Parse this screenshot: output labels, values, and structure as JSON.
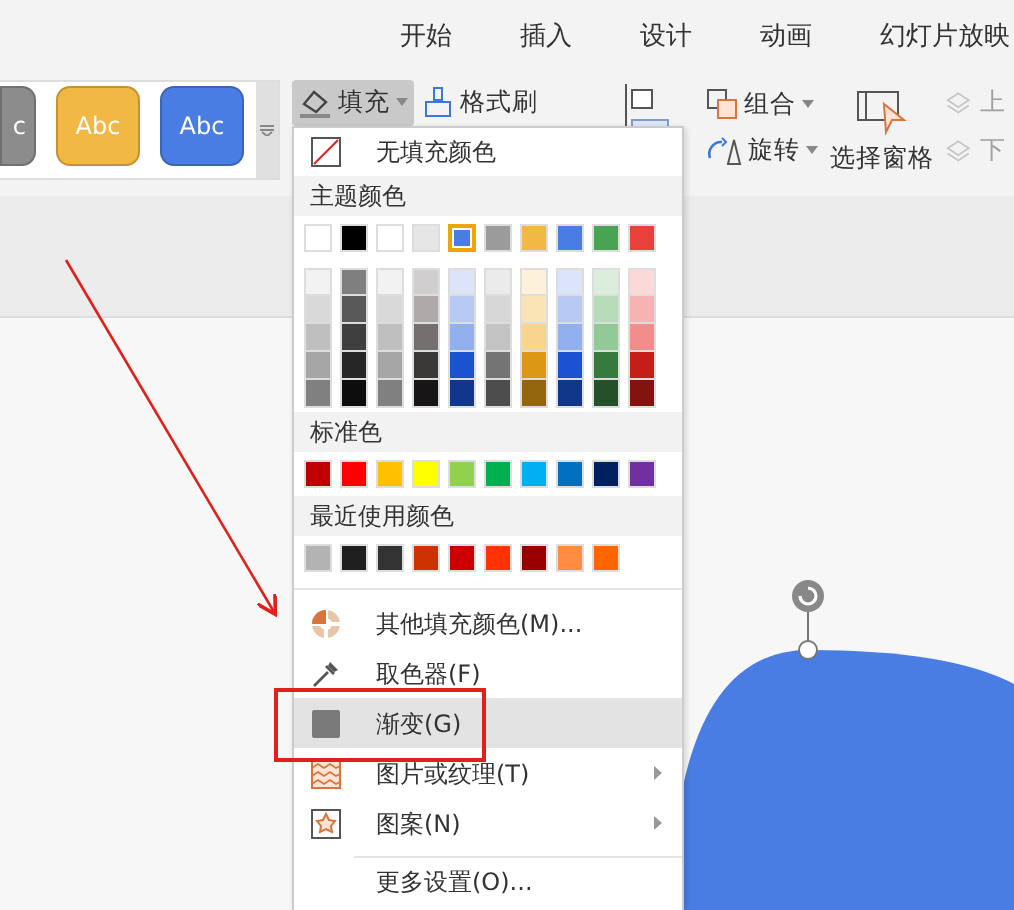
{
  "ribbon_tabs": [
    {
      "label": "开始"
    },
    {
      "label": "插入"
    },
    {
      "label": "设计"
    },
    {
      "label": "动画"
    },
    {
      "label": "幻灯片放映"
    }
  ],
  "style_gallery": [
    {
      "label": "c",
      "color": "#8c8c8c"
    },
    {
      "label": "Abc",
      "color": "#f2b844"
    },
    {
      "label": "Abc",
      "color": "#4a7de3"
    }
  ],
  "toolbar": {
    "fill_button": {
      "label": "填充",
      "pressed": true
    },
    "format_painter": {
      "label": "格式刷"
    },
    "group": {
      "label": "组合"
    },
    "rotate": {
      "label": "旋转"
    },
    "selection_pane": {
      "label": "选择窗格"
    },
    "bring_forward": {
      "label": "上",
      "disabled": true
    },
    "send_backward": {
      "label": "下",
      "disabled": true
    }
  },
  "fill_menu": {
    "no_fill": "无填充颜色",
    "theme_header": "主题颜色",
    "theme_colors": [
      {
        "color": "#ffffff",
        "selected": false
      },
      {
        "color": "#000000",
        "selected": false
      },
      {
        "color": "#ffffff",
        "selected": false
      },
      {
        "color": "#e7e6e6",
        "selected": false
      },
      {
        "color": "#4a7de3",
        "selected": true
      },
      {
        "color": "#9b9b9b",
        "selected": false
      },
      {
        "color": "#f2b844",
        "selected": false
      },
      {
        "color": "#4a7de3",
        "selected": false
      },
      {
        "color": "#4aa352",
        "selected": false
      },
      {
        "color": "#e8413c",
        "selected": false
      }
    ],
    "shade_rows": [
      {
        "swatches": [
          {
            "color": "#f2f2f2"
          },
          {
            "color": "#7f7f7f"
          },
          {
            "color": "#f2f2f2"
          },
          {
            "color": "#d0cece"
          },
          {
            "color": "#dbe4f9"
          },
          {
            "color": "#ebebeb"
          },
          {
            "color": "#fdf1d9"
          },
          {
            "color": "#dbe4f9"
          },
          {
            "color": "#dbeddc"
          },
          {
            "color": "#fad9d8"
          }
        ]
      },
      {
        "swatches": [
          {
            "color": "#d9d9d9"
          },
          {
            "color": "#595959"
          },
          {
            "color": "#d9d9d9"
          },
          {
            "color": "#aeaaaa"
          },
          {
            "color": "#b7caf3"
          },
          {
            "color": "#d7d7d7"
          },
          {
            "color": "#fae3b4"
          },
          {
            "color": "#b7caf3"
          },
          {
            "color": "#b6dbb9"
          },
          {
            "color": "#f6b3b1"
          }
        ]
      },
      {
        "swatches": [
          {
            "color": "#bfbfbf"
          },
          {
            "color": "#3f3f3f"
          },
          {
            "color": "#bfbfbf"
          },
          {
            "color": "#757070"
          },
          {
            "color": "#92afee"
          },
          {
            "color": "#c3c3c3"
          },
          {
            "color": "#f8d48e"
          },
          {
            "color": "#92afee"
          },
          {
            "color": "#92c997"
          },
          {
            "color": "#f18d8a"
          }
        ]
      },
      {
        "swatches": [
          {
            "color": "#a6a6a6"
          },
          {
            "color": "#262626"
          },
          {
            "color": "#a6a6a6"
          },
          {
            "color": "#3b3838"
          },
          {
            "color": "#1a52d0"
          },
          {
            "color": "#747474"
          },
          {
            "color": "#dc9812"
          },
          {
            "color": "#1a52d0"
          },
          {
            "color": "#377a3d"
          },
          {
            "color": "#c51d17"
          }
        ]
      },
      {
        "swatches": [
          {
            "color": "#808080"
          },
          {
            "color": "#0d0d0d"
          },
          {
            "color": "#808080"
          },
          {
            "color": "#171515"
          },
          {
            "color": "#11378a"
          },
          {
            "color": "#4d4d4d"
          },
          {
            "color": "#93650c"
          },
          {
            "color": "#11378a"
          },
          {
            "color": "#245129"
          },
          {
            "color": "#83130f"
          }
        ]
      }
    ],
    "standard_header": "标准色",
    "standard_colors": [
      {
        "color": "#c00000"
      },
      {
        "color": "#ff0000"
      },
      {
        "color": "#ffc000"
      },
      {
        "color": "#ffff00"
      },
      {
        "color": "#92d050"
      },
      {
        "color": "#00b050"
      },
      {
        "color": "#00b0f0"
      },
      {
        "color": "#0070c0"
      },
      {
        "color": "#002060"
      },
      {
        "color": "#7030a0"
      }
    ],
    "recent_header": "最近使用颜色",
    "recent_colors": [
      {
        "color": "#b3b3b3"
      },
      {
        "color": "#1f1f1f"
      },
      {
        "color": "#333333"
      },
      {
        "color": "#cc3300"
      },
      {
        "color": "#cc0000"
      },
      {
        "color": "#ff3300"
      },
      {
        "color": "#990000"
      },
      {
        "color": "#ff8c40"
      },
      {
        "color": "#ff6600"
      }
    ],
    "items": [
      {
        "label": "其他填充颜色(M)...",
        "kind": "palette",
        "submenu": false,
        "selected": false,
        "separator_before": false
      },
      {
        "label": "取色器(F)",
        "kind": "eyedropper",
        "submenu": false,
        "selected": false,
        "separator_before": false
      },
      {
        "label": "渐变(G)",
        "kind": "gradient",
        "submenu": false,
        "selected": true,
        "separator_before": false
      },
      {
        "label": "图片或纹理(T)",
        "kind": "texture",
        "submenu": true,
        "selected": false,
        "separator_before": false
      },
      {
        "label": "图案(N)",
        "kind": "pattern",
        "submenu": true,
        "selected": false,
        "separator_before": false
      },
      {
        "label": "更多设置(O)...",
        "kind": "plain",
        "submenu": false,
        "selected": false,
        "separator_before": true
      }
    ]
  }
}
